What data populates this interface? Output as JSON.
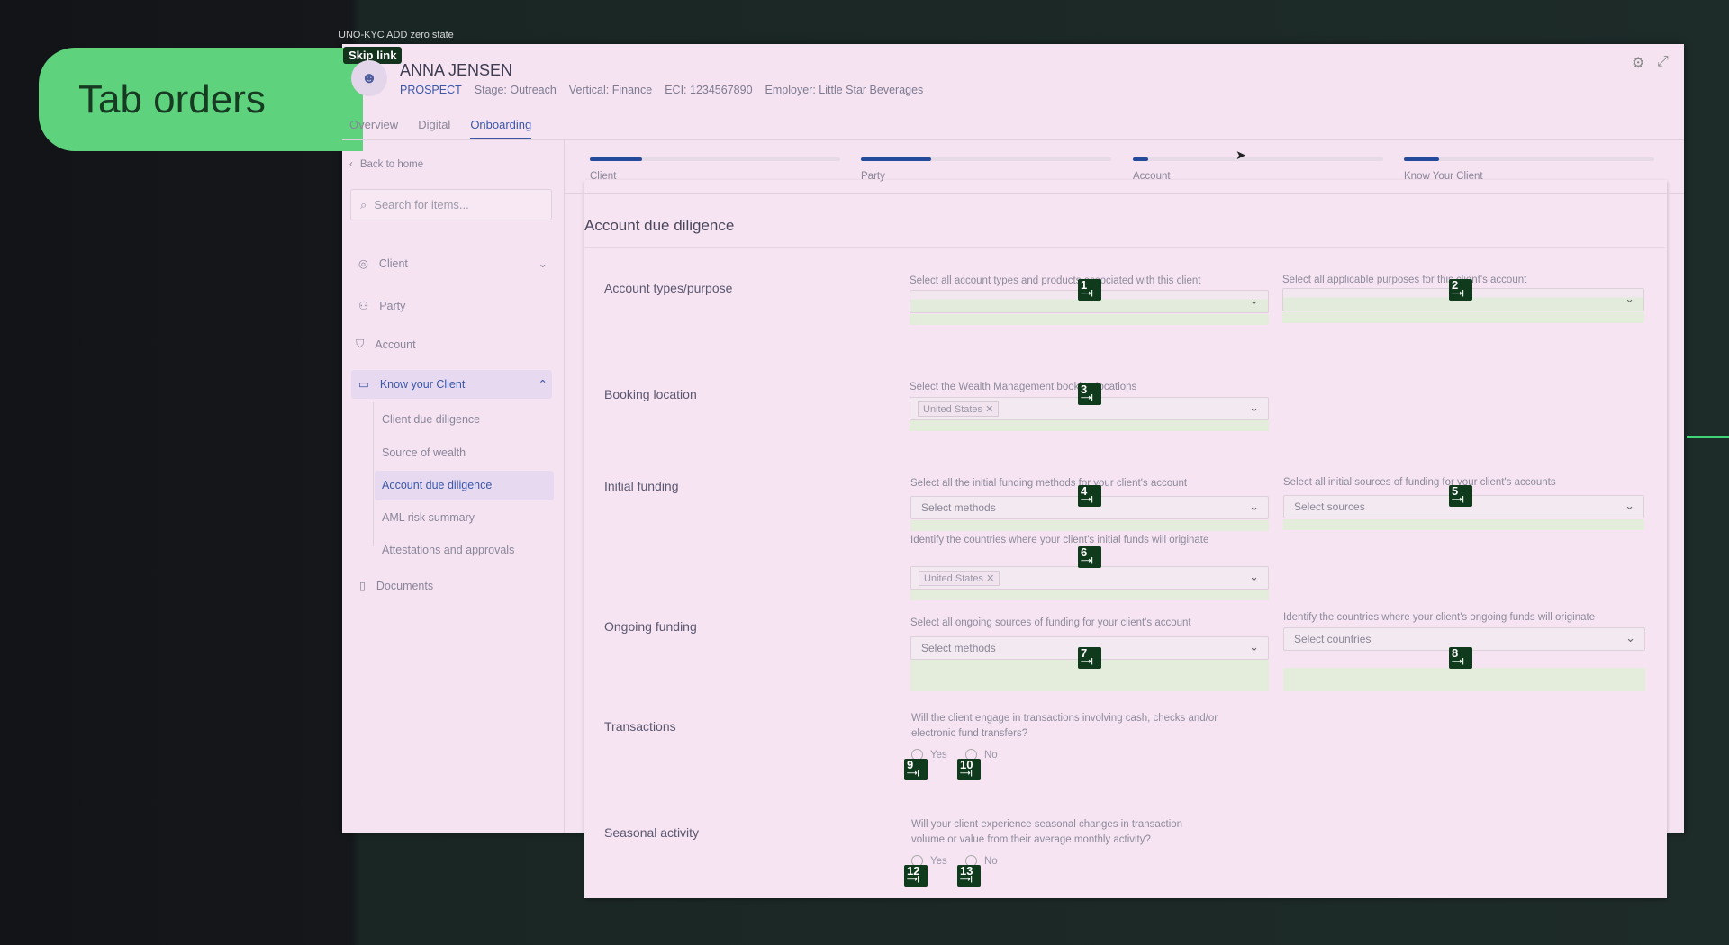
{
  "window_title": "UNO-KYC ADD zero state",
  "overlay_label": "Tab orders",
  "skip_link": "Skip link",
  "header": {
    "name": "ANNA JENSEN",
    "status": "PROSPECT",
    "stage": "Stage: Outreach",
    "vertical": "Vertical: Finance",
    "eci": "ECI: 1234567890",
    "employer": "Employer: Little Star Beverages"
  },
  "tabs": [
    "Overview",
    "Digital",
    "Onboarding"
  ],
  "active_tab": "Onboarding",
  "sidebar": {
    "back": "Back to home",
    "search_placeholder": "Search for items...",
    "items": [
      "Client",
      "Party",
      "Account",
      "Know your Client",
      "Documents"
    ],
    "sub_items": [
      "Client due diligence",
      "Source of wealth",
      "Account due diligence",
      "AML risk summary",
      "Attestations and approvals"
    ],
    "active": "Account due diligence"
  },
  "progress": [
    {
      "label": "Client",
      "percent": 21
    },
    {
      "label": "Party",
      "percent": 28
    },
    {
      "label": "Account",
      "percent": 6
    },
    {
      "label": "Know Your Client",
      "percent": 14
    }
  ],
  "section_title": "Account due diligence",
  "rows": {
    "account_types": {
      "label": "Account types/purpose",
      "f1": "Select all account types and products associated with this client",
      "f2": "Select all applicable purposes for this client's account"
    },
    "booking": {
      "label": "Booking location",
      "f1": "Select the Wealth Management booking locations",
      "chip": "United States"
    },
    "initial": {
      "label": "Initial funding",
      "f1": "Select all the initial funding methods for your client's account",
      "p1": "Select methods",
      "f2": "Select all initial sources of funding for your client's accounts",
      "p2": "Select sources",
      "f3": "Identify the countries where your client's initial funds will originate",
      "chip": "United States"
    },
    "ongoing": {
      "label": "Ongoing funding",
      "f1": "Select all ongoing sources of funding for your client's account",
      "p1": "Select methods",
      "f2": "Identify the countries where your client's ongoing funds will originate",
      "p2": "Select countries"
    },
    "transactions": {
      "label": "Transactions",
      "q1": "Will the client engage in transactions involving cash, checks and/or",
      "q2": "electronic fund transfers?",
      "yes": "Yes",
      "no": "No"
    },
    "seasonal": {
      "label": "Seasonal activity",
      "q1": "Will your client experience seasonal changes in transaction",
      "q2": "volume or value from their average monthly activity?",
      "yes": "Yes",
      "no": "No"
    }
  },
  "tab_order_badges": [
    "1",
    "2",
    "3",
    "4",
    "5",
    "6",
    "7",
    "8",
    "9",
    "10",
    "12",
    "13"
  ],
  "colors": {
    "accent": "#244a9b",
    "badge": "#0f3a1c",
    "overlay": "#5fd27d"
  }
}
